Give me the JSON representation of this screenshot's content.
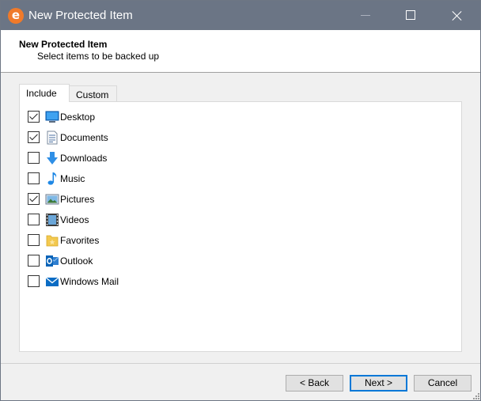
{
  "window": {
    "title": "New Protected Item"
  },
  "header": {
    "title": "New Protected Item",
    "subtitle": "Select items to be backed up"
  },
  "tabs": [
    {
      "label": "Include",
      "selected": true
    },
    {
      "label": "Custom",
      "selected": false
    }
  ],
  "items": [
    {
      "label": "Desktop",
      "checked": true,
      "icon": "desktop-icon"
    },
    {
      "label": "Documents",
      "checked": true,
      "icon": "documents-icon"
    },
    {
      "label": "Downloads",
      "checked": false,
      "icon": "downloads-icon"
    },
    {
      "label": "Music",
      "checked": false,
      "icon": "music-icon"
    },
    {
      "label": "Pictures",
      "checked": true,
      "icon": "pictures-icon"
    },
    {
      "label": "Videos",
      "checked": false,
      "icon": "videos-icon"
    },
    {
      "label": "Favorites",
      "checked": false,
      "icon": "favorites-icon"
    },
    {
      "label": "Outlook",
      "checked": false,
      "icon": "outlook-icon"
    },
    {
      "label": "Windows Mail",
      "checked": false,
      "icon": "windows-mail-icon"
    }
  ],
  "buttons": {
    "back": "< Back",
    "next": "Next >",
    "cancel": "Cancel"
  },
  "colors": {
    "titlebar": "#6b7585",
    "app_icon": "#f07a2a",
    "accent": "#0078d7"
  }
}
